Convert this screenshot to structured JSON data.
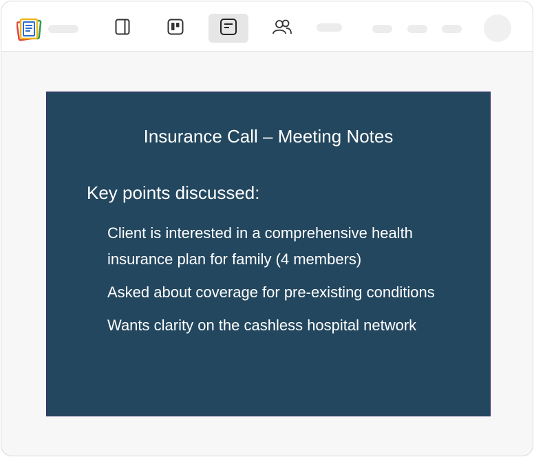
{
  "note": {
    "title": "Insurance Call – Meeting Notes",
    "heading": "Key points discussed:",
    "points": [
      "Client is interested in a comprehensive health insurance plan for family (4 members)",
      "Asked about coverage for pre-existing conditions",
      "Wants clarity on the cashless hospital network"
    ]
  },
  "toolbar": {
    "tools": [
      {
        "icon": "sidebar-panel-icon",
        "active": false
      },
      {
        "icon": "board-icon",
        "active": false
      },
      {
        "icon": "note-icon",
        "active": true
      },
      {
        "icon": "people-icon",
        "active": false
      }
    ]
  },
  "colors": {
    "card_background": "#23475f",
    "card_text": "#ffffff",
    "active_tool": "#e6e6e6"
  }
}
